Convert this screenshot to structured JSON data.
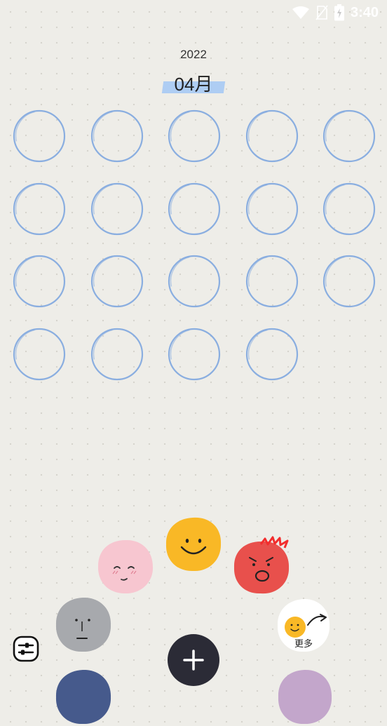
{
  "status_bar": {
    "time": "3:40",
    "icons": [
      "wifi-icon",
      "no-sim-icon",
      "battery-charging-icon"
    ]
  },
  "calendar": {
    "year": "2022",
    "month": "04月",
    "day_count": 19,
    "colors": {
      "circle_stroke": "#7ea6df",
      "tape": "#aecdf3"
    }
  },
  "mood_picker": {
    "moods": [
      "shy-pink",
      "happy-yellow",
      "angry-red",
      "neutral-gray",
      "sad-blue",
      "purple"
    ],
    "more_label": "更多",
    "colors": {
      "pink": "#f7c6d0",
      "yellow": "#f9b826",
      "red": "#e8504c",
      "gray": "#a7a9ad",
      "blue": "#465a8c",
      "purple": "#c3a6cb"
    }
  },
  "toolbar": {
    "settings_icon": "sliders-icon",
    "add_icon": "plus-icon"
  }
}
